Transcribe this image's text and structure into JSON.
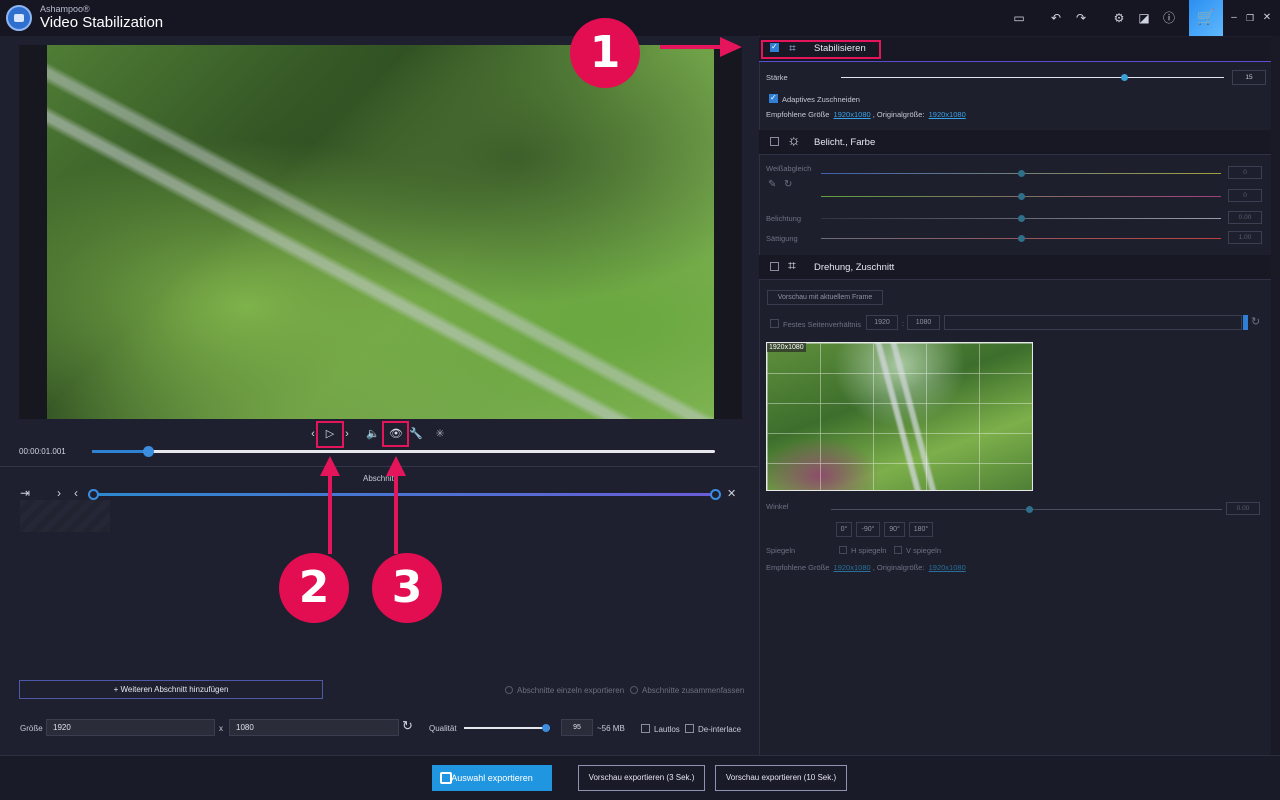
{
  "app": {
    "brand": "Ashampoo®",
    "title": "Video Stabilization"
  },
  "player": {
    "timecode": "00:00:01.001",
    "position_fraction": 0.09,
    "section_label": "Abschnitt",
    "section_start_fraction": 0.0,
    "section_end_fraction": 1.0
  },
  "left_bottom": {
    "add_section": "Weiteren Abschnitt hinzufügen",
    "export_single": "Abschnitte einzeln exportieren",
    "export_merge": "Abschnitte zusammenfassen",
    "size_label": "Größe",
    "width": "1920",
    "height": "1080",
    "x_sep": "x",
    "quality_label": "Qualität",
    "quality_value": "95",
    "quality_fraction": 0.95,
    "file_size": "~56 MB",
    "lossless": "Lautlos",
    "deinterlace": "De-interlace"
  },
  "footer": {
    "export_selection": "Auswahl exportieren",
    "preview3": "Vorschau exportieren (3 Sek.)",
    "preview10": "Vorschau exportieren (10 Sek.)"
  },
  "stabilize": {
    "title": "Stabilisieren",
    "checked": true,
    "strength_label": "Stärke",
    "strength_value": "15",
    "strength_fraction": 0.74,
    "adaptive_crop": "Adaptives Zuschneiden",
    "recommended_label": "Empfohlene Größe",
    "recommended_value": "1920x1080",
    "original_label": ", Originalgröße:",
    "original_value": "1920x1080"
  },
  "exposure": {
    "title": "Belicht., Farbe",
    "checked": false,
    "white_balance": "Weißabgleich",
    "wb1_value": "0",
    "wb2_value": "0",
    "exposure_label": "Belichtung",
    "exposure_value": "0.00",
    "saturation_label": "Sättigung",
    "saturation_value": "1.00"
  },
  "rotation": {
    "title": "Drehung, Zuschnitt",
    "checked": false,
    "preview_button": "Vorschau mit aktuellem Frame",
    "fixed_ratio": "Festes Seitenverhältnis",
    "ratio_w": "1920",
    "ratio_sep": ":",
    "ratio_h": "1080",
    "preview_tag": "1920x1080",
    "angle_label": "Winkel",
    "angle_value": "0.00",
    "angle_buttons": [
      "0°",
      "-90°",
      "90°",
      "180°"
    ],
    "mirror_label": "Spiegeln",
    "mirror_h": "H spiegeln",
    "mirror_v": "V spiegeln",
    "recommended_label": "Empfohlene Größe",
    "recommended_value": "1920x1080",
    "original_label": ", Originalgröße:",
    "original_value": "1920x1080"
  },
  "annotations": [
    "1",
    "2",
    "3"
  ],
  "colors": {
    "accent": "#2196e0",
    "highlight": "#e30e52",
    "background": "#1e2030"
  }
}
